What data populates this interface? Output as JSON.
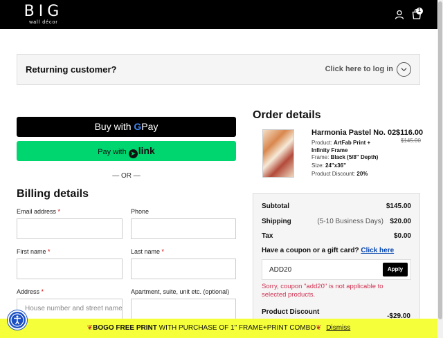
{
  "header": {
    "logo_main": "BIG",
    "logo_sub": "wall décor",
    "cart_count": "1",
    "icons": [
      "account-icon",
      "cart-icon"
    ]
  },
  "returning": {
    "title": "Returning customer?",
    "login_link": "Click here to log in",
    "icon": "chevron-down-icon"
  },
  "express": {
    "gpay_prefix": "Buy with",
    "gpay_g": "G",
    "gpay_word": "Pay",
    "link_prefix": "Pay with",
    "link_word": "link",
    "or_text": "— OR —"
  },
  "billing": {
    "title": "Billing details",
    "email_label": "Email address",
    "phone_label": "Phone",
    "first_name_label": "First name",
    "last_name_label": "Last name",
    "address_label": "Address",
    "apartment_label": "Apartment, suite, unit etc. (optional)",
    "address_placeholder": "House number and street name",
    "required_mark": "*"
  },
  "order": {
    "title": "Order details",
    "product": {
      "name": "Harmonia Pastel No. 02",
      "price": "$116.00",
      "old_price": "$145.00",
      "product_label": "Product:",
      "product_value": "ArtFab Print + Infinity Frame",
      "frame_label": "Frame:",
      "frame_value": "Black (5/8\" Depth)",
      "size_label": "Size:",
      "size_value": "24\"x36\"",
      "discount_label": "Product Discount:",
      "discount_value": "20%"
    },
    "summary": {
      "subtotal_label": "Subtotal",
      "subtotal_value": "$145.00",
      "shipping_label": "Shipping",
      "shipping_note": "(5-10 Business Days)",
      "shipping_value": "$20.00",
      "tax_label": "Tax",
      "tax_value": "$0.00",
      "coupon_question": "Have a coupon or a gift card?",
      "coupon_link": "Click here",
      "coupon_code": "ADD20",
      "apply_label": "Apply",
      "coupon_error": "Sorry, coupon \"add20\" is not applicable to selected products.",
      "product_discount_label": "Product Discount",
      "product_discount_value": "-$29.00"
    }
  },
  "promo": {
    "emoji": "❦",
    "bold_text": "BOGO FREE PRINT",
    "rest_text": " WITH PURCHASE OF 1\" FRAME+PRINT COMBO",
    "dismiss": "Dismiss"
  },
  "accessibility": {
    "icon": "accessibility-icon"
  }
}
